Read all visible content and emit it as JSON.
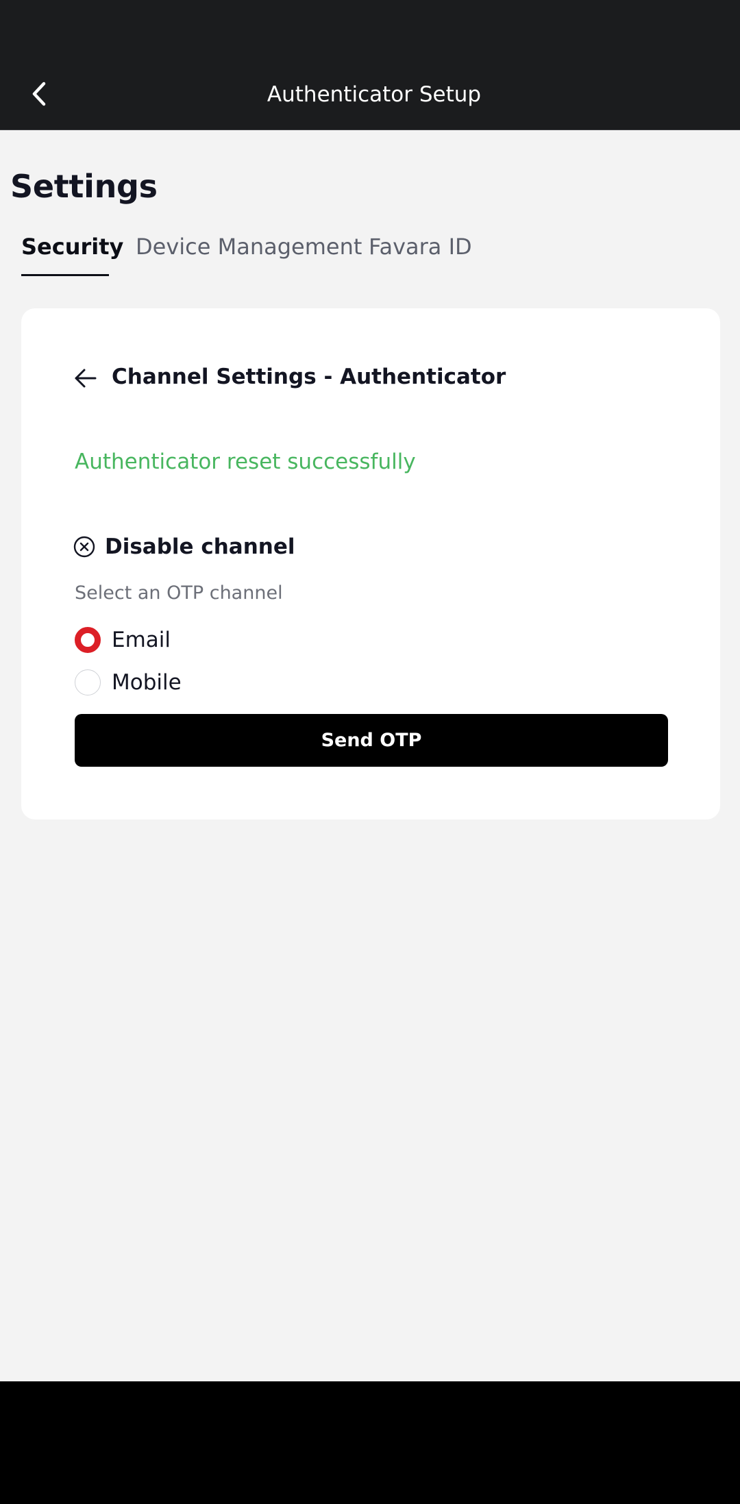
{
  "app_bar": {
    "title": "Authenticator Setup",
    "back_icon": "chevron-left-icon"
  },
  "page": {
    "title": "Settings"
  },
  "tabs": [
    {
      "label": "Security",
      "active": true
    },
    {
      "label": "Device Management",
      "active": false
    },
    {
      "label": "Favara ID",
      "active": false
    }
  ],
  "card": {
    "back_icon": "arrow-left-icon",
    "heading": "Channel Settings - Authenticator",
    "success_message": "Authenticator reset successfully",
    "disable": {
      "icon": "close-circle-icon",
      "label": "Disable channel"
    },
    "otp_prompt": "Select an OTP channel",
    "options": [
      {
        "label": "Email",
        "selected": true
      },
      {
        "label": "Mobile",
        "selected": false
      }
    ],
    "send_button": "Send OTP"
  },
  "colors": {
    "app_bar": "#1b1c1e",
    "background": "#f3f3f3",
    "success": "#48b65f",
    "radio_selected": "#dc1f26",
    "primary_button": "#000000"
  }
}
